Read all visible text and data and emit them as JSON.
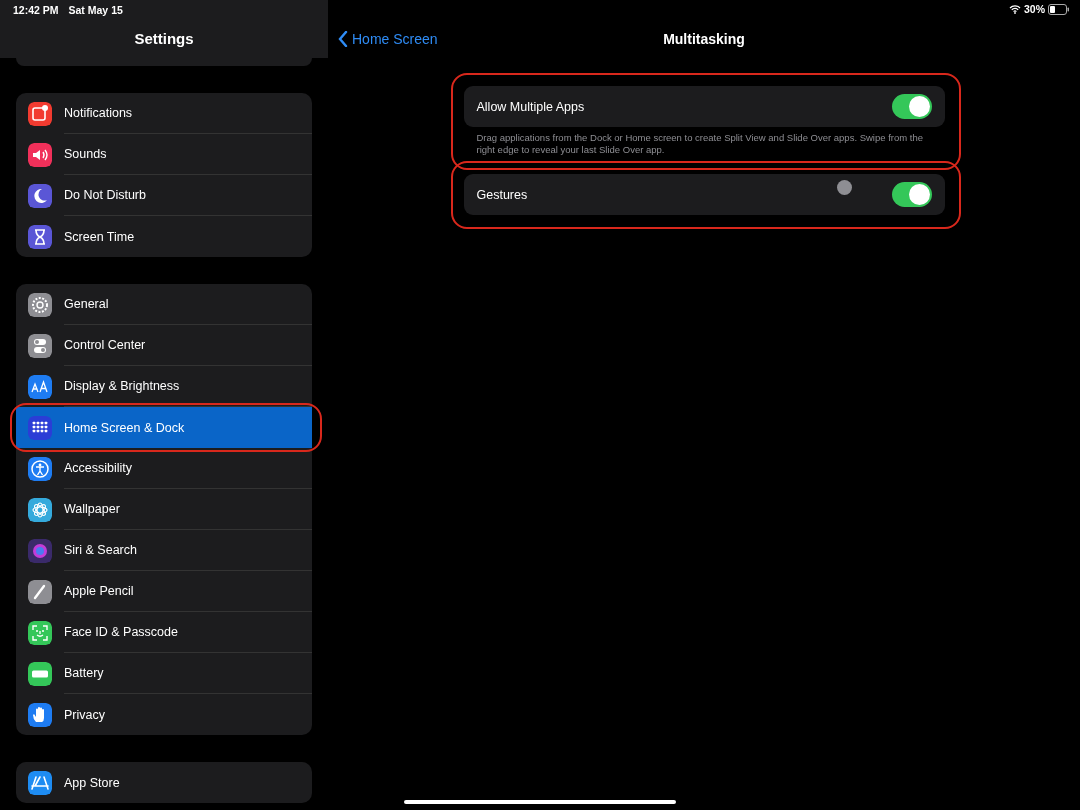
{
  "status_bar": {
    "time": "12:42 PM",
    "date": "Sat May 15",
    "battery": "30%"
  },
  "sidebar": {
    "title": "Settings",
    "groups": [
      {
        "items": [
          {
            "label": "Notifications",
            "color": "#f23b30",
            "selected": false
          },
          {
            "label": "Sounds",
            "color": "#f0305a",
            "selected": false
          },
          {
            "label": "Do Not Disturb",
            "color": "#5a56d6",
            "selected": false
          },
          {
            "label": "Screen Time",
            "color": "#5a56d6",
            "selected": false
          }
        ]
      },
      {
        "items": [
          {
            "label": "General",
            "color": "#8e8e93",
            "selected": false
          },
          {
            "label": "Control Center",
            "color": "#8e8e93",
            "selected": false
          },
          {
            "label": "Display & Brightness",
            "color": "#1e7cf2",
            "selected": false
          },
          {
            "label": "Home Screen & Dock",
            "color": "#2b3dd6",
            "selected": true,
            "highlighted": true
          },
          {
            "label": "Accessibility",
            "color": "#1e7cf2",
            "selected": false
          },
          {
            "label": "Wallpaper",
            "color": "#35aadc",
            "selected": false
          },
          {
            "label": "Siri & Search",
            "color": "#3a2a6a",
            "selected": false
          },
          {
            "label": "Apple Pencil",
            "color": "#8e8e93",
            "selected": false
          },
          {
            "label": "Face ID & Passcode",
            "color": "#34c759",
            "selected": false
          },
          {
            "label": "Battery",
            "color": "#34c759",
            "selected": false
          },
          {
            "label": "Privacy",
            "color": "#1e7cf2",
            "selected": false
          }
        ]
      },
      {
        "items": [
          {
            "label": "App Store",
            "color": "#1e8cf2",
            "selected": false
          }
        ]
      }
    ]
  },
  "detail": {
    "back": "Home Screen",
    "title": "Multitasking",
    "settings": [
      {
        "label": "Allow Multiple Apps",
        "on": true,
        "highlighted": true,
        "footer": "Drag applications from the Dock or Home screen to create Split View and Slide Over apps. Swipe from the right edge to reveal your last Slide Over app."
      },
      {
        "label": "Gestures",
        "on": true,
        "highlighted": true,
        "cursor": true
      }
    ]
  }
}
